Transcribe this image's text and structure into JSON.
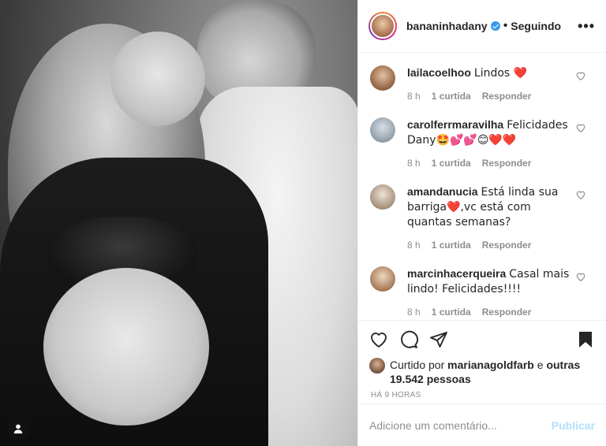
{
  "header": {
    "username": "bananinhadany",
    "separator": "•",
    "follow_status": "Seguindo",
    "more": "•••"
  },
  "comments": [
    {
      "username": "lailacoelhoo",
      "text": "Lindos ❤️",
      "time": "8 h",
      "likes": "1 curtida",
      "reply": "Responder"
    },
    {
      "username": "carolferrmaravilha",
      "text": "Felicidades Dany🤩💕💕😊❤️❤️",
      "time": "8 h",
      "likes": "1 curtida",
      "reply": "Responder"
    },
    {
      "username": "amandanucia",
      "text": "Está linda sua barriga❤️,vc está com quantas semanas?",
      "time": "8 h",
      "likes": "1 curtida",
      "reply": "Responder"
    },
    {
      "username": "marcinhacerqueira",
      "text": "Casal mais lindo! Felicidades!!!!",
      "time": "8 h",
      "likes": "1 curtida",
      "reply": "Responder"
    }
  ],
  "likes": {
    "prefix": "Curtido por",
    "user": "marianagoldfarb",
    "connector": "e",
    "others": "outras 19.542 pessoas"
  },
  "timestamp": "HÁ 9 HORAS",
  "add_comment": {
    "placeholder": "Adicione um comentário...",
    "publish": "Publicar"
  },
  "colors": {
    "verified": "#3897f0",
    "heart": "#ed4956",
    "muted": "#8e8e8e",
    "publish_disabled": "#b2dffc"
  }
}
